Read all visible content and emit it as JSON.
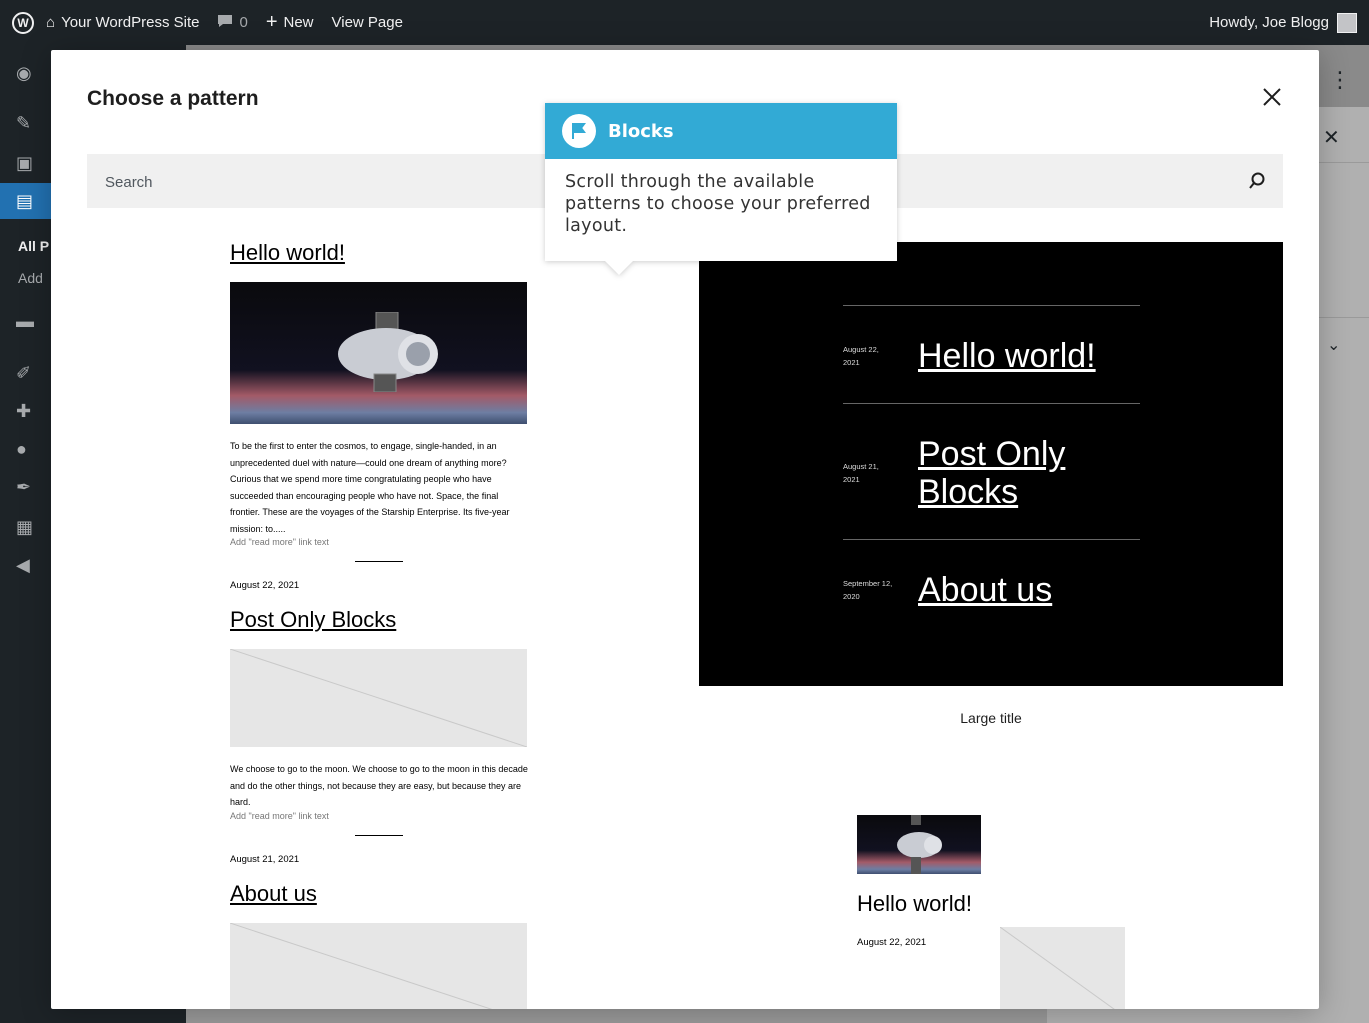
{
  "adminbar": {
    "site_name": "Your WordPress Site",
    "comments_count": "0",
    "new_label": "New",
    "view_page_label": "View Page",
    "howdy": "Howdy, Joe Blogg"
  },
  "sidebar": {
    "sub_all": "All P",
    "sub_add": "Add"
  },
  "modal": {
    "title": "Choose a pattern",
    "search_placeholder": "Search"
  },
  "tooltip": {
    "title": "Blocks",
    "body": "Scroll through the available patterns to choose your preferred layout."
  },
  "pattern_list": {
    "read_more_label": "Add \"read more\" link text",
    "posts": [
      {
        "title": "Hello world!",
        "excerpt": "To be the first to enter the cosmos, to engage, single-handed, in an unprecedented duel with nature—could one dream of anything more? Curious that we spend more time congratulating people who have succeeded than encouraging people who have not. Space, the final frontier. These are the voyages of the Starship Enterprise. Its five-year mission: to.....",
        "date": "August 22, 2021"
      },
      {
        "title": "Post Only Blocks",
        "excerpt": "We choose to go to the moon. We choose to go to the moon in this decade and do the other things, not because they are easy, but because they are hard.",
        "date": "August 21, 2021"
      },
      {
        "title": "About us"
      }
    ]
  },
  "large_title_pattern": {
    "caption": "Large title",
    "entries": [
      {
        "date": "August 22, 2021",
        "title": "Hello world!"
      },
      {
        "date": "August 21, 2021",
        "title": "Post Only Blocks"
      },
      {
        "date": "September 12, 2020",
        "title": "About us"
      }
    ]
  },
  "grid_pattern": {
    "title": "Hello world!",
    "date": "August 22, 2021"
  },
  "colors": {
    "accent": "#32aad5",
    "admin_bar": "#1d2327",
    "menu_active": "#2271b1"
  }
}
